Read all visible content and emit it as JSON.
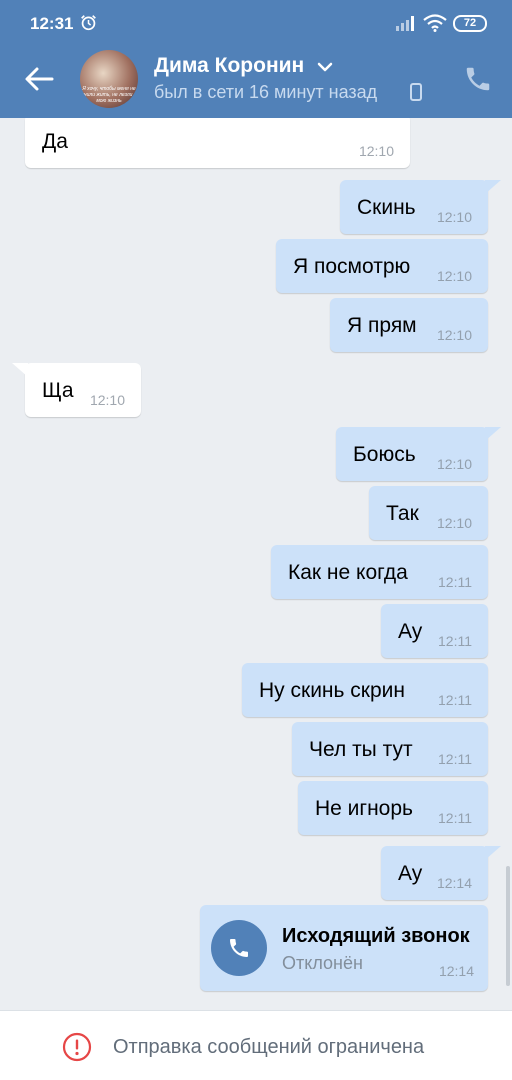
{
  "status_bar": {
    "time": "12:31",
    "battery": "72"
  },
  "header": {
    "name": "Дима Коронин",
    "status": "был в сети 16 минут назад",
    "avatar_caption": "Я хочу, чтобы меня не учили жить, не лезли в мою жизнь"
  },
  "messages": [
    {
      "dir": "in",
      "text": "Да",
      "time": "12:10"
    },
    {
      "dir": "out",
      "text": "Скинь",
      "time": "12:10"
    },
    {
      "dir": "out",
      "text": "Я посмотрю",
      "time": "12:10"
    },
    {
      "dir": "out",
      "text": "Я прям",
      "time": "12:10"
    },
    {
      "dir": "in",
      "text": "Ща",
      "time": "12:10"
    },
    {
      "dir": "out",
      "text": "Боюсь",
      "time": "12:10"
    },
    {
      "dir": "out",
      "text": "Так",
      "time": "12:10"
    },
    {
      "dir": "out",
      "text": "Как не когда",
      "time": "12:11"
    },
    {
      "dir": "out",
      "text": "Ау",
      "time": "12:11"
    },
    {
      "dir": "out",
      "text": "Ну скинь скрин",
      "time": "12:11"
    },
    {
      "dir": "out",
      "text": "Чел ты тут",
      "time": "12:11"
    },
    {
      "dir": "out",
      "text": "Не игнорь",
      "time": "12:11"
    },
    {
      "dir": "out",
      "text": "Ау",
      "time": "12:14"
    }
  ],
  "call": {
    "title": "Исходящий звонок",
    "status": "Отклонён",
    "time": "12:14"
  },
  "footer": {
    "text": "Отправка сообщений ограничена"
  },
  "colors": {
    "header": "#5181b8",
    "outgoing": "#cce1f9",
    "incoming": "#ffffff",
    "background": "#ebeef2",
    "warning": "#e64646"
  }
}
